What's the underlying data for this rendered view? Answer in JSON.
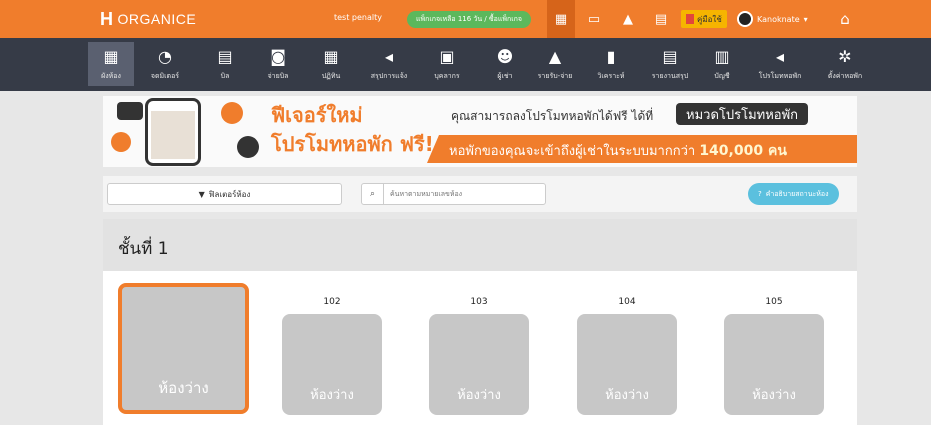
{
  "topbar": {
    "logo_text": "ORGANICE",
    "user_label": "test penalty",
    "package_badge": "แพ็กเกจเหลือ 116 วัน / ซื้อแพ็กเกจ",
    "manual_label": "คู่มือใช้",
    "username": "Kanoknate",
    "brand_color": "#f07d2c",
    "icons": [
      "hotel-icon",
      "card-icon",
      "bell-icon",
      "store-icon",
      "home-icon"
    ]
  },
  "toolbar": {
    "items": [
      {
        "label": "ผังห้อง",
        "icon": "floorplan-icon"
      },
      {
        "label": "จดมิเตอร์",
        "icon": "meter-icon"
      },
      {
        "label": "บิล",
        "icon": "bill-icon"
      },
      {
        "label": "จ่ายบิล",
        "icon": "pay-bill-icon"
      },
      {
        "label": "ปฏิทิน",
        "icon": "calendar-icon"
      },
      {
        "label": "สรุปการแจ้ง",
        "icon": "announce-summary-icon"
      },
      {
        "label": "บุคลากร",
        "icon": "staff-icon"
      },
      {
        "label": "ผู้เช่า",
        "icon": "tenants-icon"
      },
      {
        "label": "รายรับ-จ่าย",
        "icon": "income-expense-icon"
      },
      {
        "label": "วิเคราะห์",
        "icon": "analytics-icon"
      },
      {
        "label": "รายงานสรุป",
        "icon": "report-icon"
      },
      {
        "label": "บัญชี",
        "icon": "account-icon"
      },
      {
        "label": "โปรโมทหอพัก",
        "icon": "promote-icon"
      },
      {
        "label": "ตั้งค่าหอพัก",
        "icon": "settings-icon"
      }
    ]
  },
  "banner": {
    "headline_1": "ฟีเจอร์ใหม่",
    "headline_2": "โปรโมทหอพัก ฟรี!",
    "subtitle": "คุณสามารถลงโปรโมทหอพักได้ฟรี ได้ที่",
    "tag": "หมวดโปรโมทหอพัก",
    "stripe_text": "หอพักของคุณจะเข้าถึงผู้เช่าในระบบมากกว่า",
    "stripe_number": "140,000 คน"
  },
  "filters": {
    "filter_button": "ฟิลเตอร์ห้อง",
    "search_placeholder": "ค้นหาตามหมายเลขห้อง",
    "status_help": "คำอธิบายสถานะห้อง"
  },
  "floor": {
    "title": "ชั้นที่ 1",
    "rooms": [
      {
        "number": "",
        "status": "ห้องว่าง",
        "selected": true
      },
      {
        "number": "102",
        "status": "ห้องว่าง",
        "selected": false
      },
      {
        "number": "103",
        "status": "ห้องว่าง",
        "selected": false
      },
      {
        "number": "104",
        "status": "ห้องว่าง",
        "selected": false
      },
      {
        "number": "105",
        "status": "ห้องว่าง",
        "selected": false
      }
    ]
  }
}
